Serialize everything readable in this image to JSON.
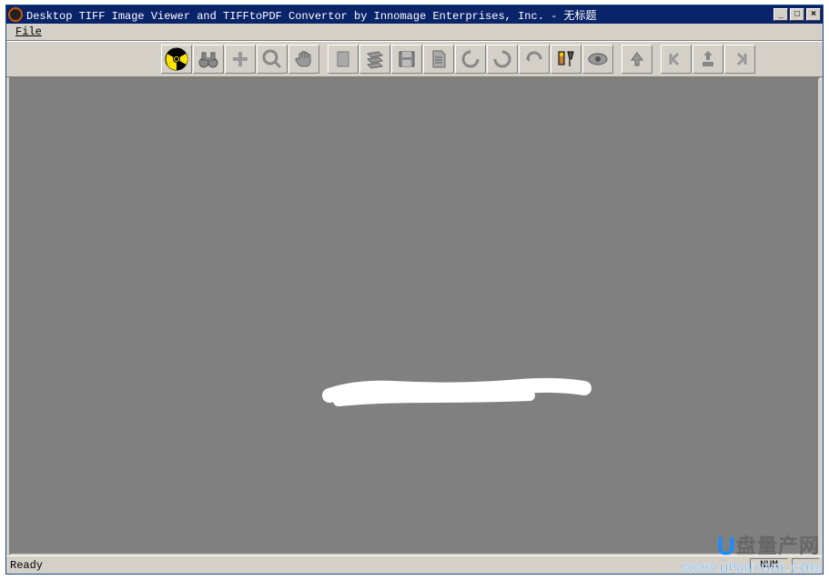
{
  "title": "Desktop TIFF Image Viewer and TIFFtoPDF Convertor by Innomage Enterprises, Inc. - 无标题",
  "menu": {
    "file": "File"
  },
  "toolbar": {
    "radiation": "radiation",
    "binoculars": "binoculars",
    "zoom_plus": "zoom-plus",
    "magnifier": "magnifier",
    "hand": "hand",
    "page": "page",
    "scan": "scan",
    "save": "save",
    "document": "document",
    "rotate_ccw": "rotate-ccw",
    "rotate_cw": "rotate-cw",
    "flip": "flip",
    "tools": "tools",
    "eye": "eye",
    "up": "up",
    "prev": "prev",
    "goto": "goto",
    "next": "next"
  },
  "status": {
    "ready": "Ready",
    "num": "NUM"
  },
  "watermark": {
    "brand": "盘量产网",
    "url": "WWW.UPANTOOL.COM"
  }
}
